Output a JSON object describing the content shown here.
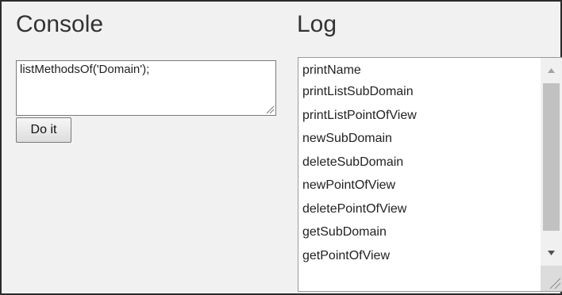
{
  "console": {
    "title": "Console",
    "input_value": "listMethodsOf('Domain');",
    "button_label": "Do it"
  },
  "log": {
    "title": "Log",
    "items": [
      "printName",
      "printListSubDomain",
      "printListPointOfView",
      "newSubDomain",
      "deleteSubDomain",
      "newPointOfView",
      "deletePointOfView",
      "getSubDomain",
      "getPointOfView"
    ]
  },
  "icons": {
    "scroll_up": "triangle-up-icon",
    "scroll_down": "triangle-down-icon",
    "resize": "resize-grip-icon"
  }
}
